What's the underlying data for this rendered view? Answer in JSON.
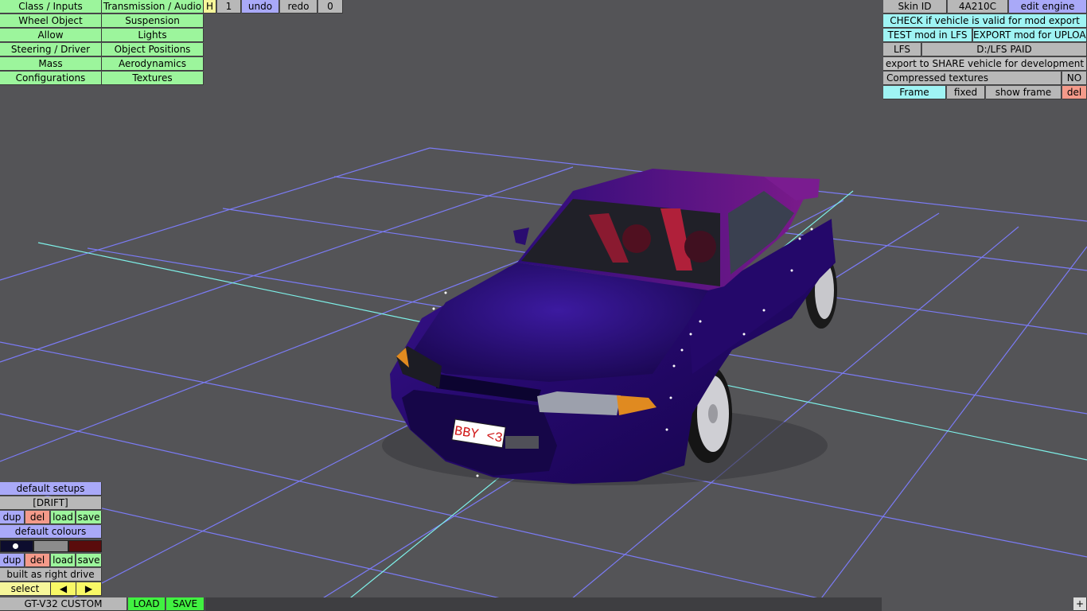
{
  "top_left_menu": {
    "class_inputs": "Class / Inputs",
    "transmission_audio": "Transmission / Audio",
    "wheel_object": "Wheel Object",
    "suspension": "Suspension",
    "allow": "Allow",
    "lights": "Lights",
    "steering_driver": "Steering / Driver",
    "object_positions": "Object Positions",
    "mass": "Mass",
    "aerodynamics": "Aerodynamics",
    "configurations": "Configurations",
    "textures": "Textures"
  },
  "history": {
    "h_label": "H",
    "h_count": "1",
    "undo": "undo",
    "redo": "redo",
    "redo_count": "0"
  },
  "top_right": {
    "skin_id_label": "Skin ID",
    "skin_id_value": "4A210C",
    "edit_engine": "edit engine",
    "check_valid": "CHECK if vehicle is valid for mod export",
    "test_mod": "TEST mod in LFS",
    "export_upload": "EXPORT mod for UPLOAD",
    "lfs": "LFS",
    "lfs_path": "D:/LFS PAID",
    "export_share": "export to SHARE vehicle for development",
    "compressed_label": "Compressed textures",
    "compressed_value": "NO",
    "frame": "Frame",
    "fixed": "fixed",
    "show_frame": "show frame",
    "del": "del"
  },
  "bottom_left": {
    "default_setups": "default setups",
    "setup_name": "[DRIFT]",
    "dup": "dup",
    "del": "del",
    "load": "load",
    "save": "save",
    "default_colours": "default colours",
    "colour_swatches": [
      "#0d0d2e",
      "#8c8c8c",
      "#5a0c0c"
    ],
    "built_as": "built as right drive",
    "select": "select",
    "prev_arrow": "◀",
    "next_arrow": "▶"
  },
  "bottom_bar": {
    "vehicle_name": "GT-V32 CUSTOM",
    "load": "LOAD",
    "save": "SAVE",
    "plus": "+"
  },
  "car": {
    "plate": "BBY <3",
    "body_color": "#2a0d6e",
    "accent_color": "#8a1a8e"
  },
  "grid": {
    "line_color": "#7b7bf5",
    "axis_color": "#7ef0e8"
  }
}
